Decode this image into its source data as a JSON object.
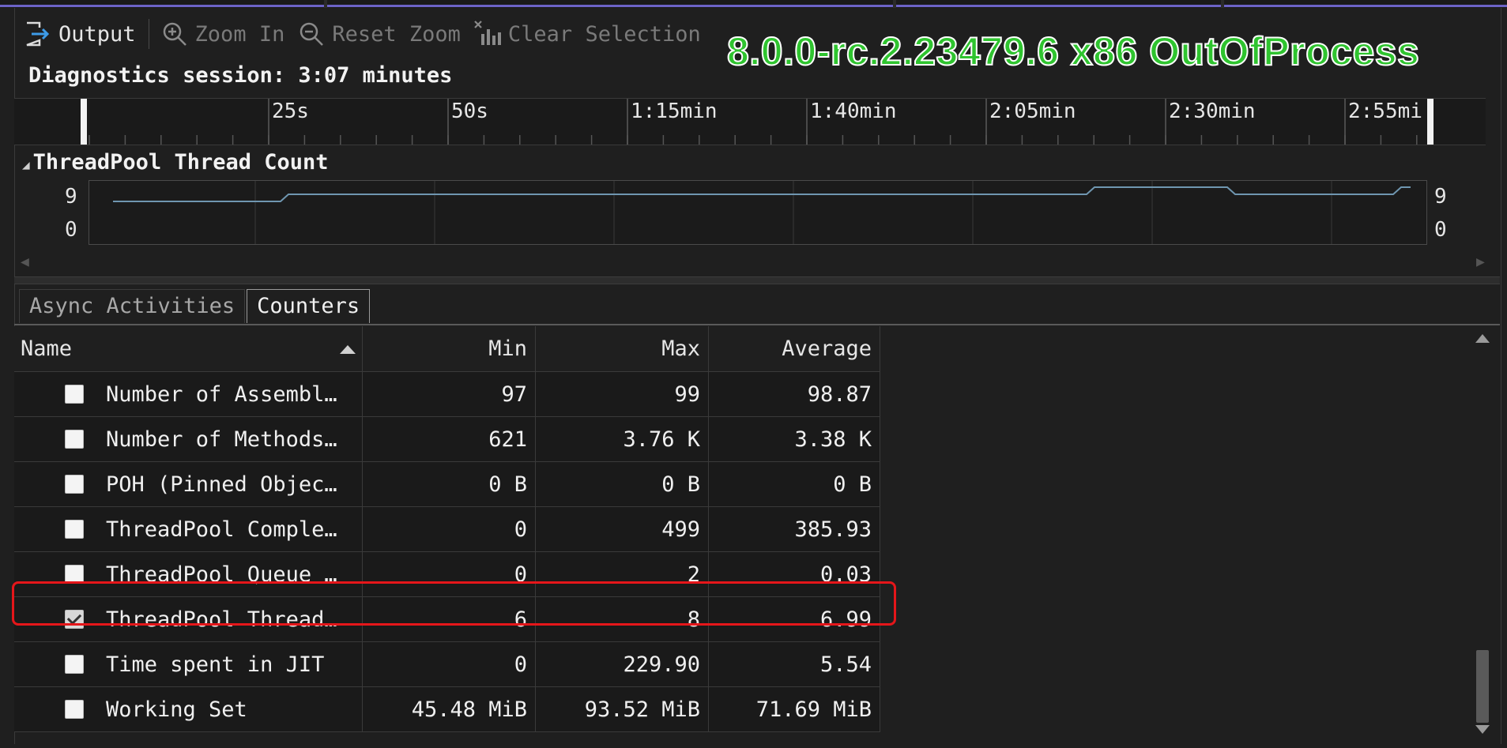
{
  "toolbar": {
    "output_label": "Output",
    "zoom_in_label": "Zoom In",
    "reset_zoom_label": "Reset Zoom",
    "clear_selection_label": "Clear Selection"
  },
  "build_label": "8.0.0-rc.2.23479.6 x86 OutOfProcess",
  "session_label": "Diagnostics session: 3:07 minutes",
  "timeline": {
    "ticks": [
      "25s",
      "50s",
      "1:15min",
      "1:40min",
      "2:05min",
      "2:30min",
      "2:55mi"
    ]
  },
  "graph": {
    "title": "ThreadPool Thread Count",
    "y_max_label": "9",
    "y_min_label": "0",
    "line_color": "#6f96b0"
  },
  "tabs": [
    {
      "label": "Async Activities",
      "active": false
    },
    {
      "label": "Counters",
      "active": true
    }
  ],
  "table": {
    "headers": {
      "name": "Name",
      "min": "Min",
      "max": "Max",
      "avg": "Average"
    },
    "rows": [
      {
        "name": "Number of Assembl…",
        "min": "97",
        "max": "99",
        "avg": "98.87",
        "checked": false
      },
      {
        "name": "Number of Methods…",
        "min": "621",
        "max": "3.76 K",
        "avg": "3.38 K",
        "checked": false
      },
      {
        "name": "POH (Pinned Objec…",
        "min": "0 B",
        "max": "0 B",
        "avg": "0 B",
        "checked": false
      },
      {
        "name": "ThreadPool Comple…",
        "min": "0",
        "max": "499",
        "avg": "385.93",
        "checked": false
      },
      {
        "name": "ThreadPool Queue …",
        "min": "0",
        "max": "2",
        "avg": "0.03",
        "checked": false
      },
      {
        "name": "ThreadPool Thread…",
        "min": "6",
        "max": "8",
        "avg": "6.99",
        "checked": true
      },
      {
        "name": "Time spent in JIT",
        "min": "0",
        "max": "229.90",
        "avg": "5.54",
        "checked": false
      },
      {
        "name": "Working Set",
        "min": "45.48 MiB",
        "max": "93.52 MiB",
        "avg": "71.69 MiB",
        "checked": false
      }
    ]
  },
  "colors": {
    "highlight": "#e5161a",
    "build_label": "#2fc42f",
    "accent": "#6c63c7"
  }
}
